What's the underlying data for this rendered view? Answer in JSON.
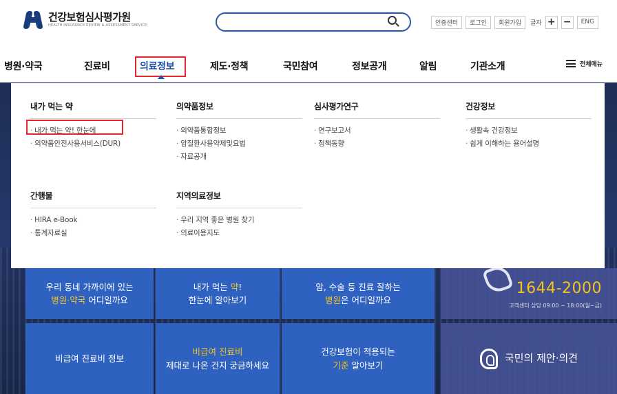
{
  "header": {
    "logo_text": "건강보험심사평가원",
    "logo_subtext": "HEALTH INSURANCE REVIEW & ASSESSMENT SERVICE",
    "search_placeholder": "",
    "util_links": [
      "인증센터",
      "로그인",
      "회원가입"
    ],
    "font_size_label": "글자",
    "font_plus": "+",
    "font_minus": "−",
    "lang": "ENG"
  },
  "gnb": {
    "items": [
      "병원·약국",
      "진료비",
      "의료정보",
      "제도·정책",
      "국민참여",
      "정보공개",
      "알림",
      "기관소개"
    ],
    "active_index": 2,
    "all_menu_label": "전체메뉴"
  },
  "mega_menu": {
    "sections": [
      {
        "title": "내가 먹는 약",
        "links": [
          "내가 먹는 약! 한눈에",
          "의약품안전사용서비스(DUR)"
        ]
      },
      {
        "title": "의약품정보",
        "links": [
          "의약품통합정보",
          "암질환사용약제및요법",
          "자료공개"
        ]
      },
      {
        "title": "심사평가연구",
        "links": [
          "연구보고서",
          "정책동향"
        ]
      },
      {
        "title": "건강정보",
        "links": [
          "생활속 건강정보",
          "쉽게 이해하는 용어설명"
        ]
      },
      {
        "title": "간행물",
        "links": [
          "HIRA e-Book",
          "통계자료실"
        ]
      },
      {
        "title": "지역의료정보",
        "links": [
          "우리 지역 좋은 병원 찾기",
          "의료이용지도"
        ]
      }
    ]
  },
  "banners": {
    "t1_line1": "우리 동네 가까이에 있는",
    "t1_hl": "병원·약국",
    "t1_rest": " 어디일까요",
    "t2_line1a": "내가 먹는 ",
    "t2_hl": "약",
    "t2_line1b": "!",
    "t2_line2": "한눈에 알아보기",
    "t3_line1": "암, 수술 등 진료 잘하는",
    "t3_hl": "병원",
    "t3_rest": "은 어디일까요",
    "cs_phone": "1644-2000",
    "cs_note": "고객센터 상담 09:00 ~ 18:00(월~금)",
    "b1": "비급여 진료비 정보",
    "b2_hl": "비급여 진료비",
    "b2_line2": "제대로 나온 건지 궁금하세요",
    "b3_line1": "건강보험이 적용되는",
    "b3_hl": "기준",
    "b3_rest": " 알아보기",
    "b4": "국민의 제안·의견"
  },
  "colors": {
    "accent": "#1d50a8",
    "highlight_box": "#e8232b",
    "tile_blue": "#2f62c0",
    "tile_yellow_text": "#f6c31a"
  }
}
